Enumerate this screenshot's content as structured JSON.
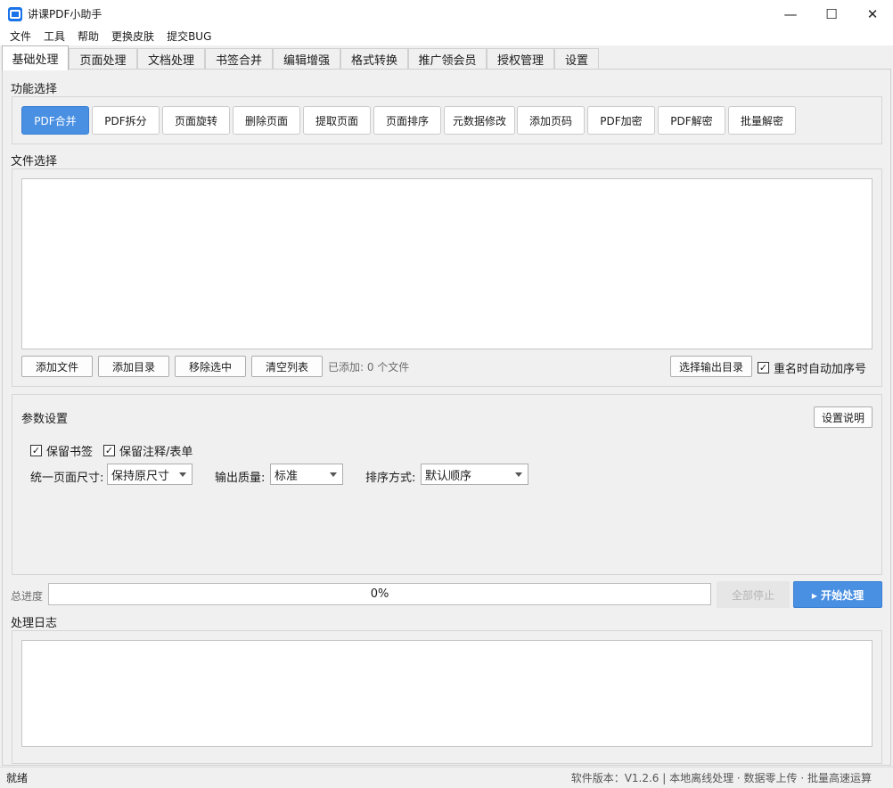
{
  "window": {
    "title": "讲课PDF小助手",
    "controls": {
      "minimize": "—",
      "maximize": "☐",
      "close": "✕"
    }
  },
  "menu": [
    "文件",
    "工具",
    "帮助",
    "更换皮肤",
    "提交BUG"
  ],
  "tabs": [
    "基础处理",
    "页面处理",
    "文档处理",
    "书签合并",
    "编辑增强",
    "格式转换",
    "推广领会员",
    "授权管理",
    "设置"
  ],
  "function_section": {
    "label": "功能选择",
    "buttons": [
      "PDF合并",
      "PDF拆分",
      "页面旋转",
      "删除页面",
      "提取页面",
      "页面排序",
      "元数据修改",
      "添加页码",
      "PDF加密",
      "PDF解密",
      "批量解密"
    ],
    "active": "PDF合并"
  },
  "file_section": {
    "label": "文件选择",
    "add_file": "添加文件",
    "add_dir": "添加目录",
    "remove_selected": "移除选中",
    "clear_list": "清空列表",
    "added_count": "已添加: 0 个文件",
    "choose_output": "选择输出目录",
    "auto_number_label": "重名时自动加序号",
    "auto_number_checked": true
  },
  "params": {
    "label": "参数设置",
    "help_button": "设置说明",
    "keep_bookmarks": "保留书签",
    "keep_annotations": "保留注释/表单",
    "page_size_label": "统一页面尺寸:",
    "page_size_value": "保持原尺寸",
    "quality_label": "输出质量:",
    "quality_value": "标准",
    "sort_label": "排序方式:",
    "sort_value": "默认顺序"
  },
  "progress": {
    "label": "总进度",
    "value_text": "0%",
    "stop_all": "全部停止",
    "start": "▸ 开始处理"
  },
  "log": {
    "label": "处理日志"
  },
  "status": {
    "left": "就绪",
    "right": "软件版本：V1.2.6 | 本地离线处理 · 数据零上传 · 批量高速运算"
  },
  "colors": {
    "accent": "#4a90e2",
    "disabled_bg": "#e6e6e6",
    "disabled_text": "#b5b5b5"
  }
}
